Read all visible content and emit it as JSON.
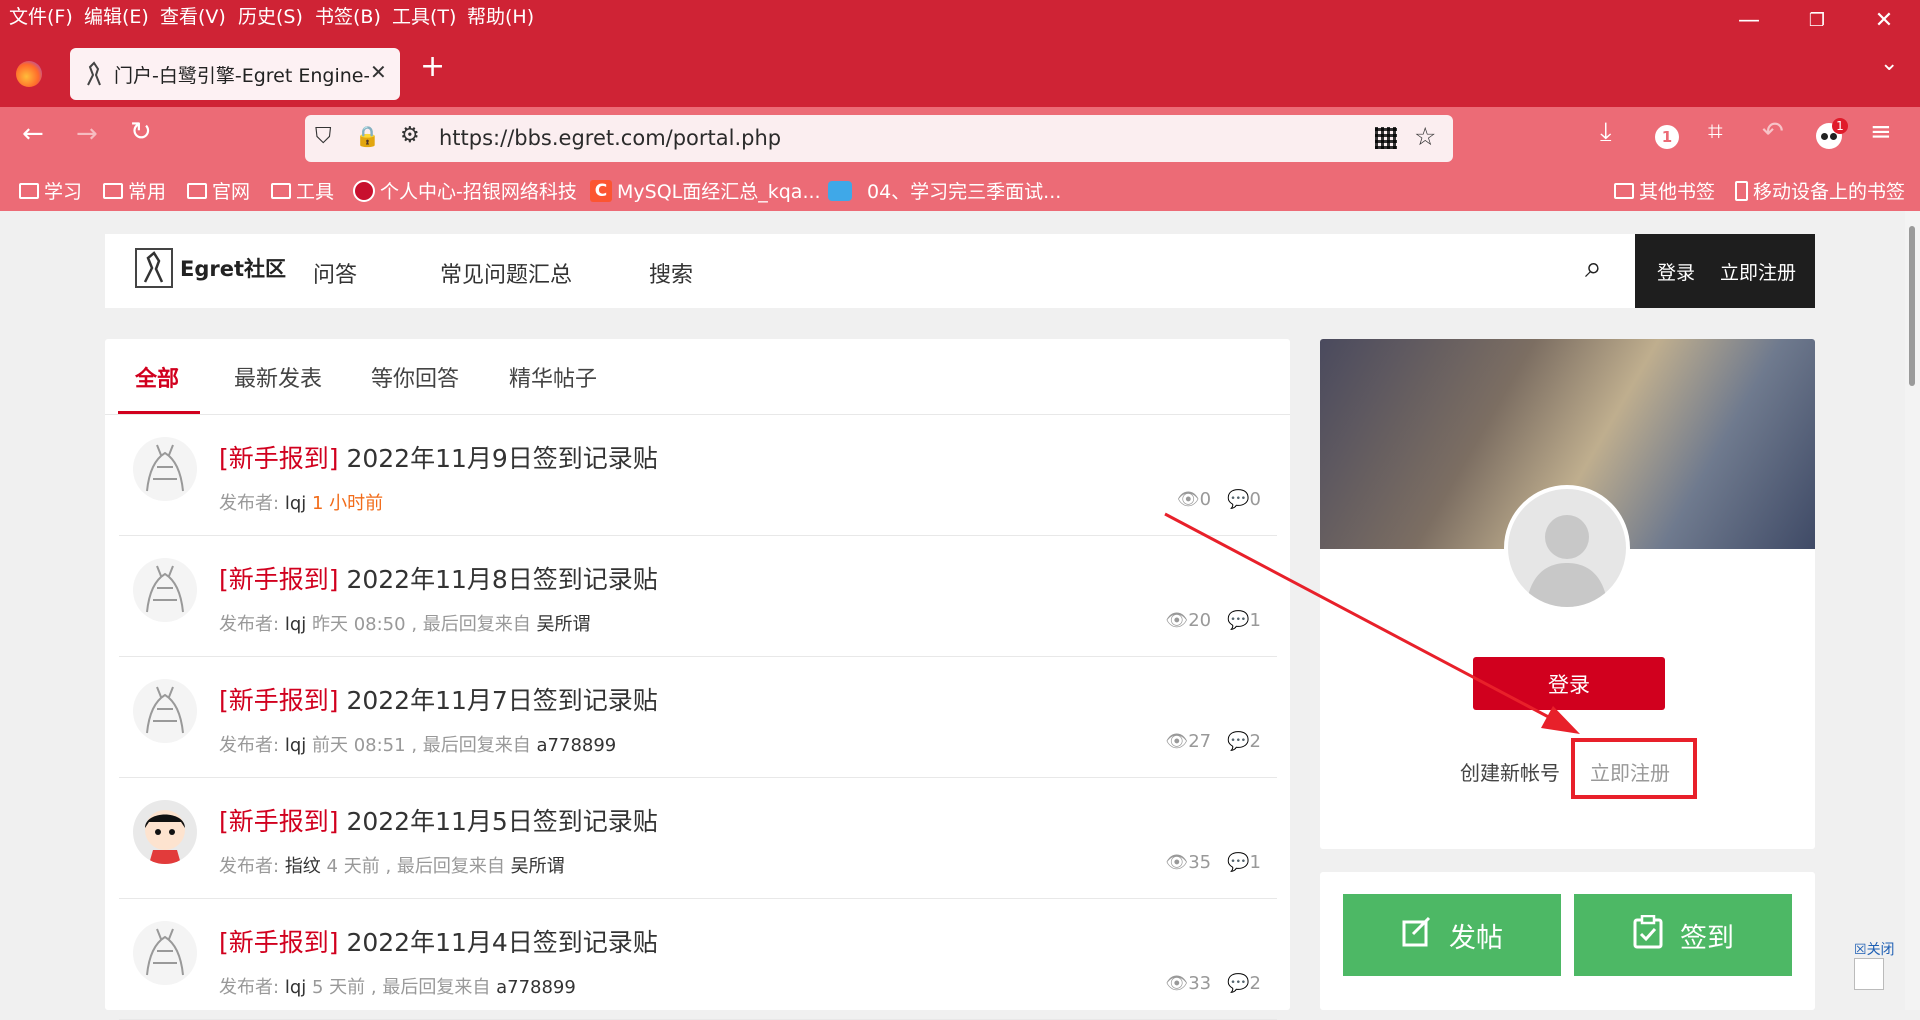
{
  "menu": [
    "文件(F)",
    "编辑(E)",
    "查看(V)",
    "历史(S)",
    "书签(B)",
    "工具(T)",
    "帮助(H)"
  ],
  "tab": {
    "title": "门户-白鹭引擎-Egret Engine-务"
  },
  "url": "https://bbs.egret.com/portal.php",
  "extension_badge": "1",
  "bookmarks": [
    "学习",
    "常用",
    "官网",
    "工具",
    "个人中心-招银网络科技",
    "MySQL面经汇总_kqa...",
    "04、学习完三季面试..."
  ],
  "bookmarks_right": [
    "其他书签",
    "移动设备上的书签"
  ],
  "site": {
    "logo": "Egret社区",
    "nav": [
      "问答",
      "常见问题汇总",
      "搜索"
    ],
    "login": "登录",
    "register": "立即注册"
  },
  "tabs": [
    "全部",
    "最新发表",
    "等你回答",
    "精华帖子"
  ],
  "posts": [
    {
      "tag": "[新手报到]",
      "title": "2022年11月9日签到记录贴",
      "prefix": "发布者:",
      "author": "lqj",
      "time": "1 小时前",
      "sep": "",
      "last": "",
      "views": "0",
      "replies": "0"
    },
    {
      "tag": "[新手报到]",
      "title": "2022年11月8日签到记录贴",
      "prefix": "发布者:",
      "author": "lqj",
      "time": "昨天 08:50",
      "sep": ", 最后回复来自",
      "last": "吴所谓",
      "views": "20",
      "replies": "1"
    },
    {
      "tag": "[新手报到]",
      "title": "2022年11月7日签到记录贴",
      "prefix": "发布者:",
      "author": "lqj",
      "time": "前天 08:51",
      "sep": ", 最后回复来自",
      "last": "a778899",
      "views": "27",
      "replies": "2"
    },
    {
      "tag": "[新手报到]",
      "title": "2022年11月5日签到记录贴",
      "prefix": "发布者:",
      "author": "指纹",
      "time": "4 天前",
      "sep": ", 最后回复来自",
      "last": "吴所谓",
      "views": "35",
      "replies": "1"
    },
    {
      "tag": "[新手报到]",
      "title": "2022年11月4日签到记录贴",
      "prefix": "发布者:",
      "author": "lqj",
      "time": "5 天前",
      "sep": ", 最后回复来自",
      "last": "a778899",
      "views": "33",
      "replies": "2"
    }
  ],
  "sidebar": {
    "login_button": "登录",
    "create_label": "创建新帐号",
    "register_link": "立即注册",
    "post_button": "发帖",
    "checkin_button": "签到"
  },
  "floating": {
    "close": "关闭"
  },
  "colors": {
    "brand_red": "#d1001e",
    "browser_red": "#cf2335",
    "green": "#4db865",
    "annotation_red": "#e8202a"
  }
}
